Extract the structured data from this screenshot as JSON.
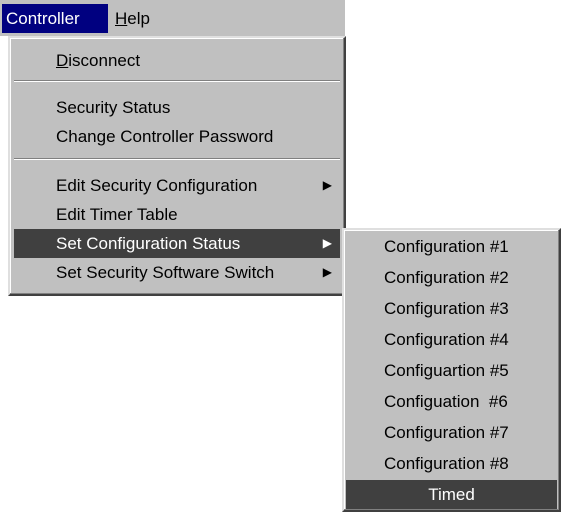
{
  "menubar": {
    "controller_label": "Controller",
    "help_label": "Help"
  },
  "controller_menu": {
    "disconnect": "Disconnect",
    "security_status": "Security Status",
    "change_password": "Change Controller Password",
    "edit_security_config": "Edit Security Configuration",
    "edit_timer_table": "Edit Timer Table",
    "set_config_status": "Set Configuration Status",
    "set_security_switch": "Set Security Software Switch"
  },
  "config_submenu": {
    "items": [
      "Configuration #1",
      "Configuration #2",
      "Configuration #3",
      "Configuration #4",
      "Configuartion #5",
      "Configuation  #6",
      "Configuration #7",
      "Configuration #8",
      "Timed"
    ],
    "selected": "Timed"
  },
  "icons": {
    "submenu_arrow": "chevron-right-icon"
  },
  "colors": {
    "menu_bg": "#c0c0c0",
    "menubar_active": "#000080",
    "item_highlight": "#404040",
    "highlight_text": "#ffffff"
  }
}
